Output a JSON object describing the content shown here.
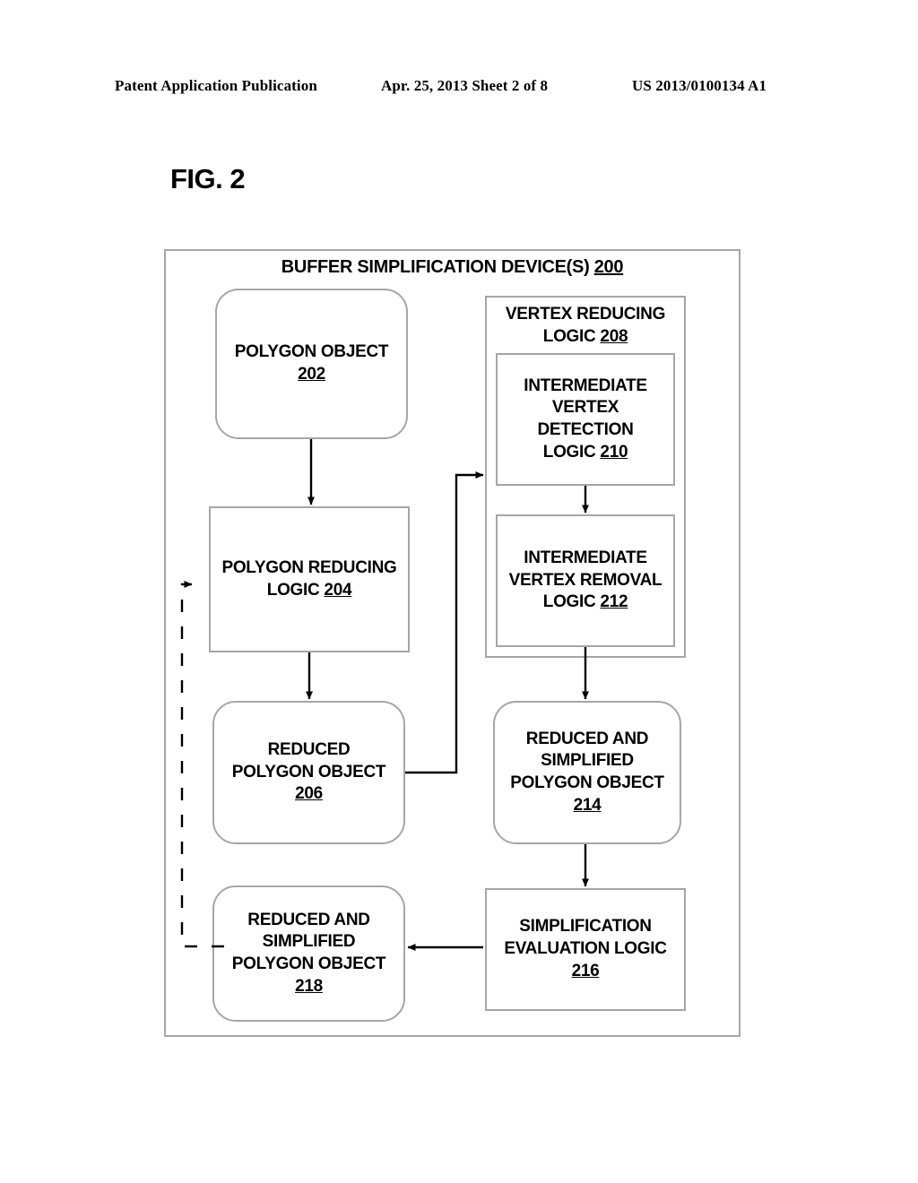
{
  "header": {
    "publication": "Patent Application Publication",
    "date_sheet": "Apr. 25, 2013  Sheet 2 of 8",
    "patent_number": "US 2013/0100134 A1"
  },
  "figure": {
    "label": "FIG. 2"
  },
  "diagram": {
    "container": {
      "title_text": "BUFFER SIMPLIFICATION DEVICE(S)",
      "title_ref": "200"
    },
    "nodes": {
      "n202": {
        "line1": "POLYGON OBJECT",
        "ref": "202",
        "shape": "rounded"
      },
      "n204": {
        "line1": "POLYGON REDUCING",
        "line2": "LOGIC",
        "ref": "204",
        "shape": "rect"
      },
      "n206": {
        "line1": "REDUCED",
        "line2": "POLYGON OBJECT",
        "ref": "206",
        "shape": "rounded"
      },
      "n208": {
        "line1": "VERTEX REDUCING",
        "line2": "LOGIC",
        "ref": "208",
        "shape": "rect"
      },
      "n210": {
        "line1": "INTERMEDIATE",
        "line2": "VERTEX DETECTION",
        "line3": "LOGIC",
        "ref": "210",
        "shape": "rect"
      },
      "n212": {
        "line1": "INTERMEDIATE",
        "line2": "VERTEX REMOVAL",
        "line3": "LOGIC",
        "ref": "212",
        "shape": "rect"
      },
      "n214": {
        "line1": "REDUCED AND",
        "line2": "SIMPLIFIED",
        "line3": "POLYGON OBJECT",
        "ref": "214",
        "shape": "rounded"
      },
      "n216": {
        "line1": "SIMPLIFICATION",
        "line2": "EVALUATION LOGIC",
        "ref": "216",
        "shape": "rect"
      },
      "n218": {
        "line1": "REDUCED AND",
        "line2": "SIMPLIFIED",
        "line3": "POLYGON OBJECT",
        "ref": "218",
        "shape": "rounded"
      }
    },
    "colors": {
      "stroke": "#a6a6a6",
      "arrow": "#000000",
      "background": "#ffffff"
    }
  }
}
